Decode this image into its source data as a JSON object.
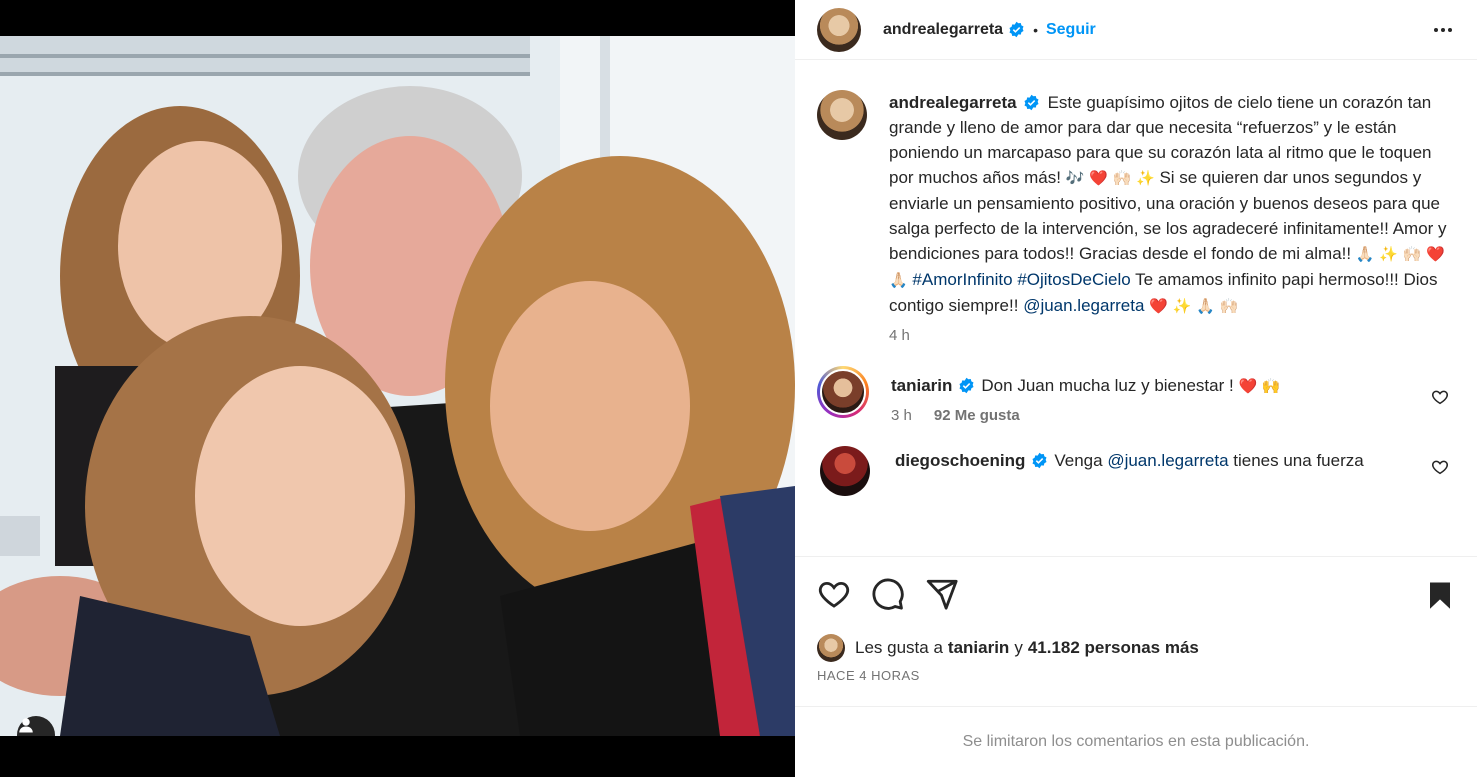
{
  "post": {
    "author": "andrealegarreta",
    "follow_label": "Seguir",
    "separator": "•"
  },
  "caption": {
    "author": "andrealegarreta",
    "text_1": "Este guapísimo ojitos de cielo tiene un corazón tan grande y lleno de amor para dar que necesita “refuerzos” y le están poniendo un marcapaso para que su corazón lata al ritmo que le toquen por muchos años más!",
    "emoji_1": "🎶",
    "emoji_2": "❤️ 🙌🏻 ✨",
    "text_2": "Si se quieren dar unos segundos y enviarle un pensamiento positivo, una oración y buenos deseos para que salga perfecto de la intervención, se los agradeceré infinitamente!! Amor y bendiciones para todos!! Gracias desde el fondo de mi alma!!",
    "emoji_3": "🙏🏻 ✨ 🙌🏻 ❤️ 🙏🏻",
    "hashtag_1": "#AmorInfinito",
    "hashtag_2": "#OjitosDeCielo",
    "text_3": "Te amamos infinito papi hermoso!!! Dios contigo siempre!!",
    "mention": "@juan.legarreta",
    "emoji_4": "❤️ ✨ 🙏🏻 🙌🏻",
    "time": "4 h"
  },
  "comments": [
    {
      "author": "taniarin",
      "text": "Don Juan mucha luz y bienestar !",
      "emoji": "❤️ 🙌",
      "time": "3 h",
      "likes": "92 Me gusta"
    },
    {
      "author": "diegoschoening",
      "text_before": "Venga",
      "mention": "@juan.legarreta",
      "text_after": "tienes una fuerza"
    }
  ],
  "likes": {
    "prefix": "Les gusta a",
    "user": "taniarin",
    "conj": "y",
    "count": "41.182 personas más"
  },
  "timestamp": "HACE 4 HORAS",
  "comments_limited": "Se limitaron los comentarios en esta publicación.",
  "colors": {
    "accent": "#0095f6",
    "link": "#00376b",
    "verified": "#0095f6",
    "muted": "#737373"
  },
  "icons": [
    "user-tag-icon",
    "verified-icon",
    "more-icon",
    "heart-icon",
    "comment-icon",
    "share-icon",
    "bookmark-icon"
  ]
}
